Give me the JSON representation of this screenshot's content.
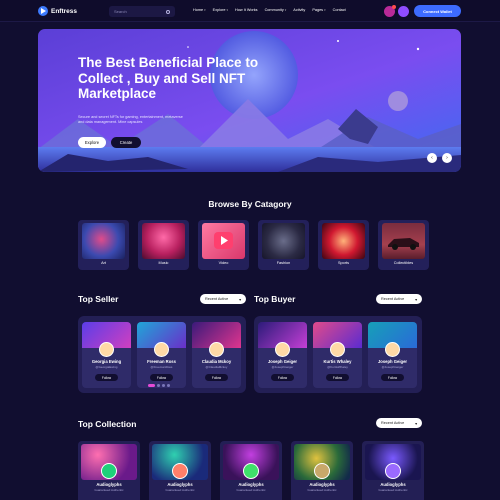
{
  "header": {
    "brand": "Enftress",
    "search_placeholder": "Search",
    "nav": [
      {
        "label": "Home",
        "caret": true
      },
      {
        "label": "Explore",
        "caret": true
      },
      {
        "label": "How It Works",
        "caret": false
      },
      {
        "label": "Community",
        "caret": true
      },
      {
        "label": "Activity",
        "caret": false
      },
      {
        "label": "Pages",
        "caret": true
      },
      {
        "label": "Contact",
        "caret": false
      }
    ],
    "connect_label": "Connect Wallet"
  },
  "hero": {
    "title": "The Best Beneficial Place to Collect , Buy and Sell NFT Marketplace",
    "description": "Secure and secret NFTs for gaming, entertainment, metaverse and data management. Mine capsules",
    "explore_label": "Explore",
    "create_label": "Create",
    "prev_icon": "arrow-left-icon",
    "next_icon": "arrow-right-icon"
  },
  "categories": {
    "title": "Browse By Catagory",
    "items": [
      {
        "label": "Art",
        "color": "#2a3a8c"
      },
      {
        "label": "Music",
        "color": "#c22f6e"
      },
      {
        "label": "Video",
        "color": "#e04a7a"
      },
      {
        "label": "Fashion",
        "color": "#2e2d4a"
      },
      {
        "label": "Sports",
        "color": "#b0122b"
      },
      {
        "label": "Collectibles",
        "color": "#8c3548"
      }
    ]
  },
  "top_seller": {
    "title": "Top Seller",
    "filter": "Recent Active",
    "people": [
      {
        "name": "Georgia Ewing",
        "handle": "@GeorgiaEwing",
        "follow": "Follow"
      },
      {
        "name": "Freeman Ross",
        "handle": "@FreemanRoss",
        "follow": "Follow"
      },
      {
        "name": "Claudia Mckoy",
        "handle": "@ClaudiaMckoy",
        "follow": "Follow"
      }
    ]
  },
  "top_buyer": {
    "title": "Top Buyer",
    "filter": "Recent Active",
    "people": [
      {
        "name": "Joseph Geiger",
        "handle": "@JosephGeiger",
        "follow": "Follow"
      },
      {
        "name": "Kurtis Whaley",
        "handle": "@KurtisWhaley",
        "follow": "Follow"
      },
      {
        "name": "Joseph Geiger",
        "handle": "@JosephGeiger",
        "follow": "Follow"
      }
    ]
  },
  "top_collection": {
    "title": "Top Collection",
    "filter": "Recent Active",
    "items": [
      {
        "name": "Audioglyphs",
        "sub": "Guaranteed Authentic"
      },
      {
        "name": "Audioglyphs",
        "sub": "Guaranteed Authentic"
      },
      {
        "name": "Audioglyphs",
        "sub": "Guaranteed Authentic"
      },
      {
        "name": "Audioglyphs",
        "sub": "Guaranteed Authentic"
      },
      {
        "name": "Audioglyphs",
        "sub": "Guaranteed Authentic"
      }
    ]
  }
}
